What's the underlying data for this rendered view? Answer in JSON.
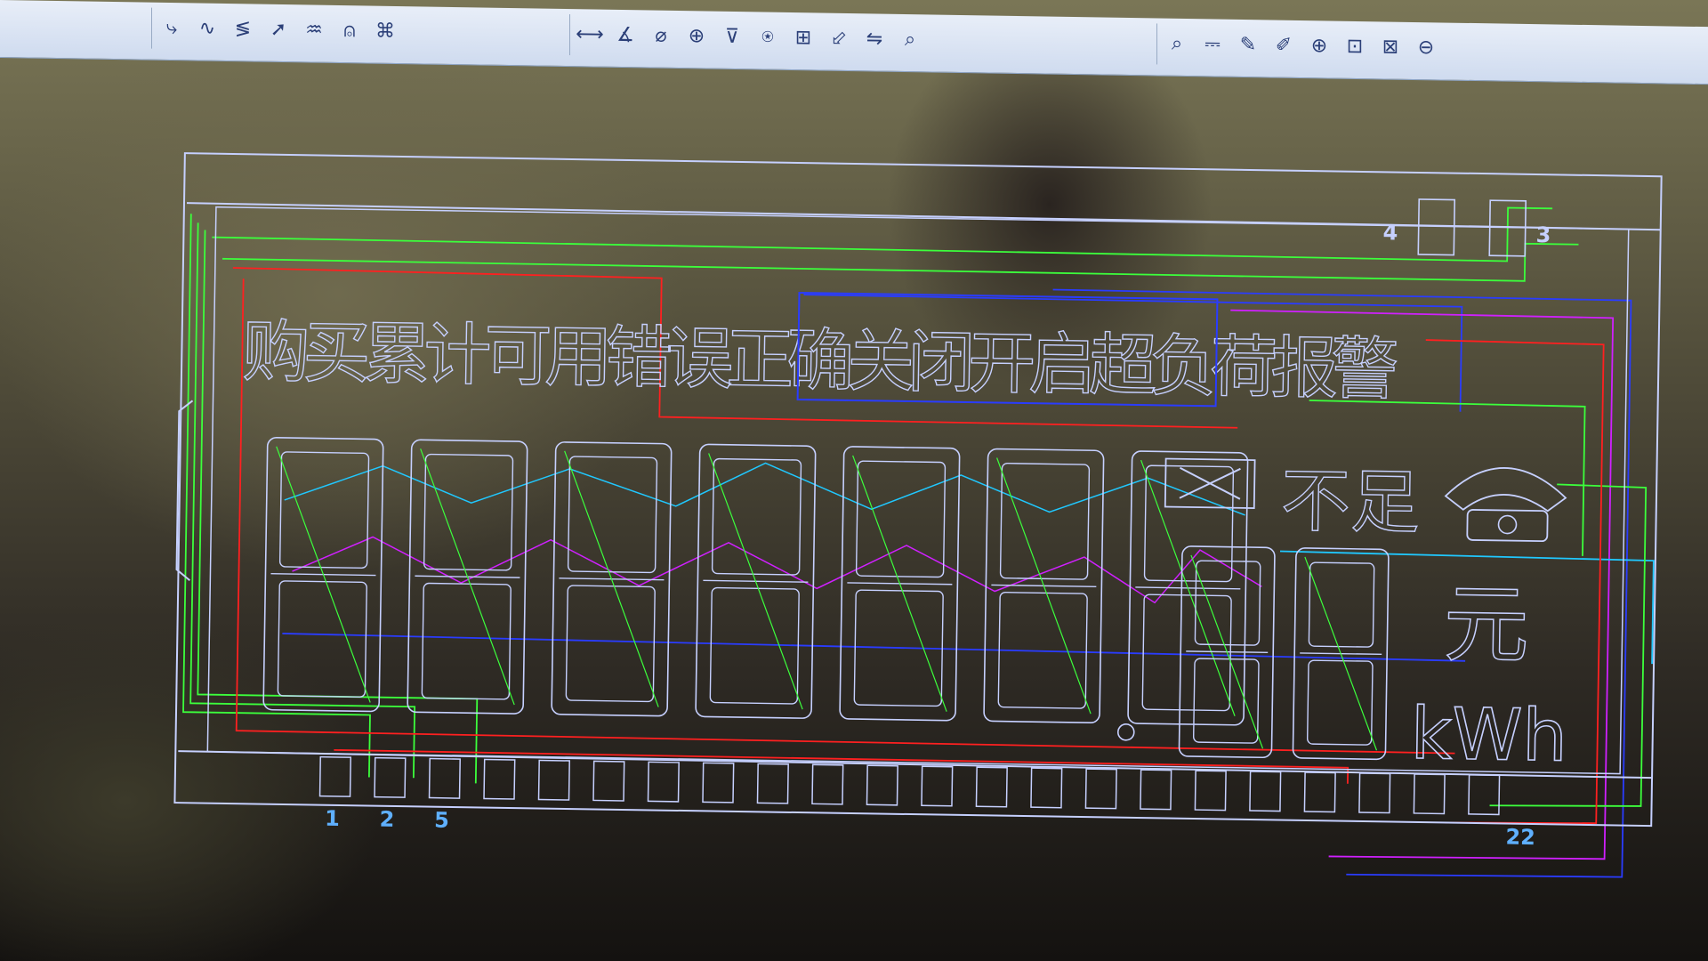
{
  "toolbar": {
    "group1": [
      {
        "icon": "wire-icon",
        "glyph": "⤷"
      },
      {
        "icon": "arc-icon",
        "glyph": "∿"
      },
      {
        "icon": "zigzag-icon",
        "glyph": "≶"
      },
      {
        "icon": "arrow-icon",
        "glyph": "➚"
      },
      {
        "icon": "curve-icon",
        "glyph": "♒"
      },
      {
        "icon": "symbol-icon",
        "glyph": "⍝"
      },
      {
        "icon": "component-icon",
        "glyph": "⌘"
      }
    ],
    "group2": [
      {
        "icon": "dimension-horizontal-icon",
        "glyph": "⟷"
      },
      {
        "icon": "dimension-angle-icon",
        "glyph": "∡"
      },
      {
        "icon": "dimension-diameter-icon",
        "glyph": "⌀"
      },
      {
        "icon": "dimension-center-icon",
        "glyph": "⊕"
      },
      {
        "icon": "dimension-vertical-icon",
        "glyph": "⊽"
      },
      {
        "icon": "dimension-point-icon",
        "glyph": "⍟"
      },
      {
        "icon": "dimension-table-icon",
        "glyph": "⊞"
      },
      {
        "icon": "dimension-leader-icon",
        "glyph": "⬃"
      },
      {
        "icon": "dimension-tolerance-icon",
        "glyph": "⇋"
      },
      {
        "icon": "dimension-inspect-icon",
        "glyph": "⌕"
      }
    ],
    "group3": [
      {
        "icon": "zoom-select-icon",
        "glyph": "⌕"
      },
      {
        "icon": "measure-icon",
        "glyph": "⎓"
      },
      {
        "icon": "pencil-icon",
        "glyph": "✎"
      },
      {
        "icon": "snap-icon",
        "glyph": "✐"
      },
      {
        "icon": "zoom-in-icon",
        "glyph": "⊕"
      },
      {
        "icon": "zoom-window-icon",
        "glyph": "⊡"
      },
      {
        "icon": "zoom-all-icon",
        "glyph": "⊠"
      },
      {
        "icon": "zoom-out-icon",
        "glyph": "⊖"
      }
    ]
  },
  "lcd": {
    "status_chars": [
      "购",
      "买",
      "累",
      "计",
      "可",
      "用",
      "错",
      "误",
      "正",
      "确",
      "关",
      "闭",
      "开",
      "启",
      "超",
      "负",
      "荷",
      "报",
      "警"
    ],
    "low_balance_label": "不足",
    "unit_yuan": "元",
    "unit_kwh": "kWh",
    "digits_large_count": 7,
    "digits_small_count": 2,
    "pin_count": 22,
    "pin_labels_bottom": [
      "1",
      "2",
      "5",
      "22"
    ],
    "pin_labels_top": [
      "4",
      "3"
    ]
  },
  "colors": {
    "outline": "#c6d0ff",
    "trace_green": "#3cff3c",
    "trace_red": "#ff2020",
    "trace_blue": "#2a3cff",
    "trace_magenta": "#d020ff",
    "trace_cyan": "#20c8ff",
    "pin_label": "#5fb0ff",
    "toolbar_bg": "#dde6f4"
  }
}
